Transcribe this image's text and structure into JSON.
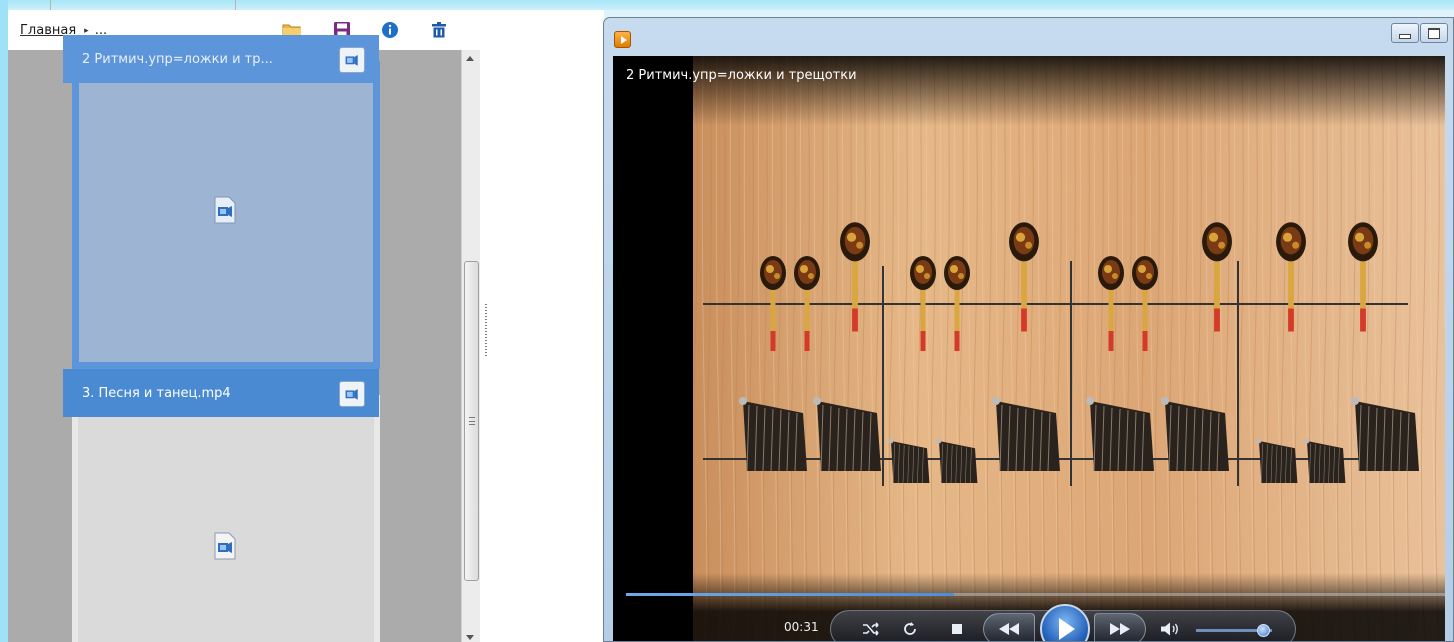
{
  "left_panel": {
    "breadcrumb": {
      "home": "Главная",
      "separator": "▸",
      "ellipsis": "..."
    },
    "toolbar_icons": [
      "open-folder-icon",
      "save-icon",
      "info-icon",
      "delete-icon"
    ],
    "cards": [
      {
        "title": "2 Ритмич.упр=ложки  и  тр...",
        "selected": true
      },
      {
        "title": "3. Песня  и  танец.mp4",
        "selected": false
      }
    ]
  },
  "player": {
    "video_title": "2 Ритмич.упр=ложки  и  трещотки",
    "current_time": "00:31",
    "progress": 0.4,
    "volume": 0.9
  },
  "colors": {
    "selected_card": "#5c95d9",
    "card_title": "#4a8ad3",
    "panel_bg": "#ababab",
    "frame": "#9fe1f7"
  }
}
